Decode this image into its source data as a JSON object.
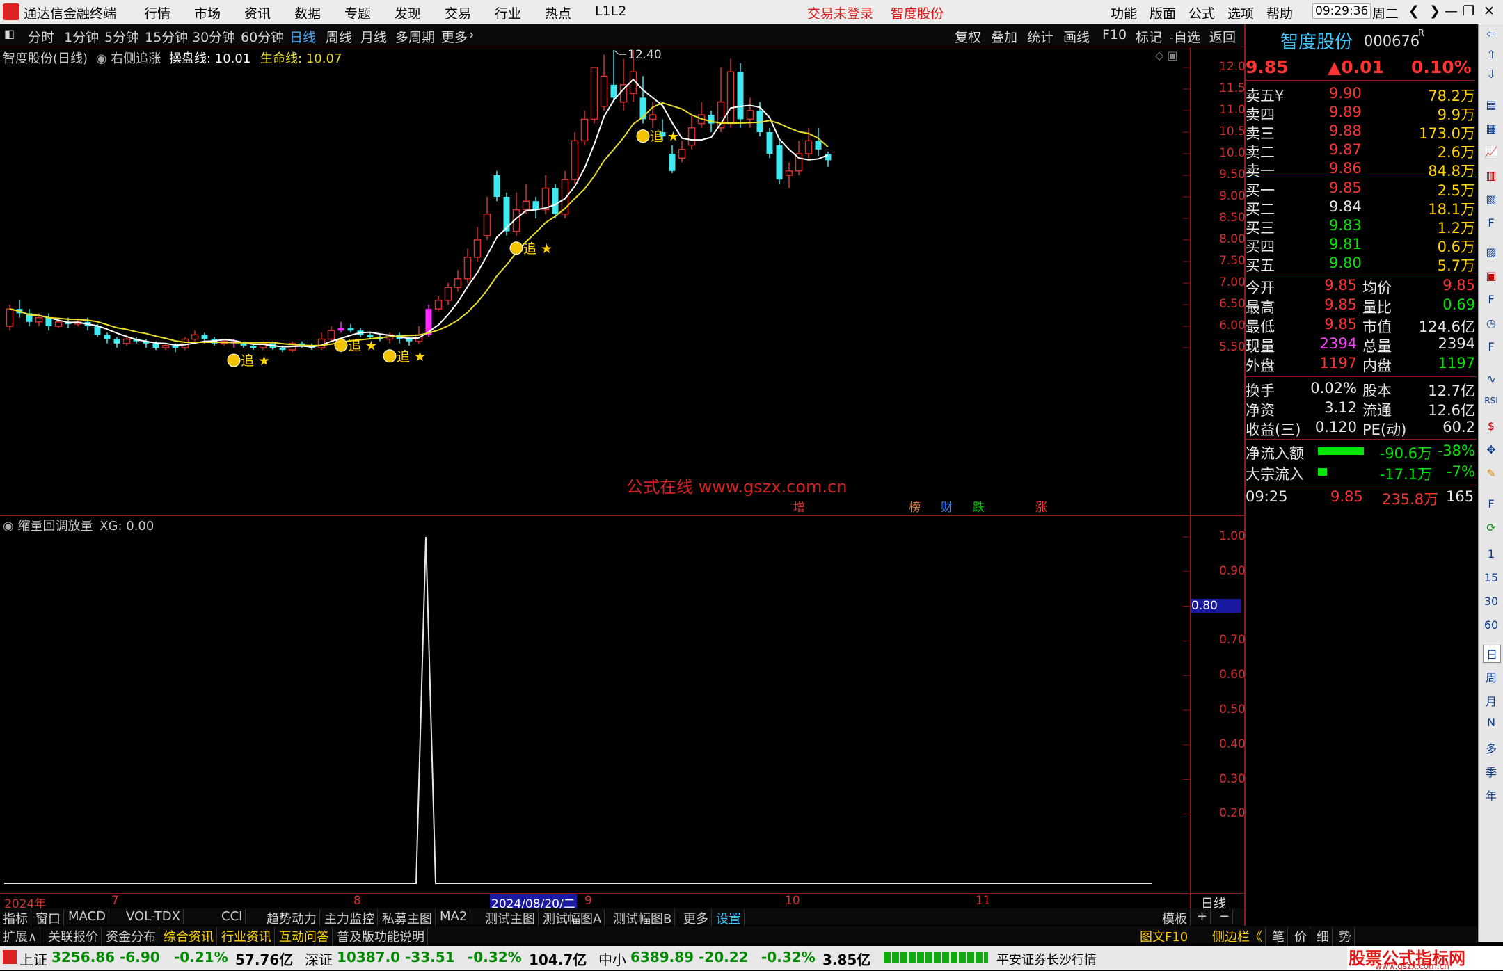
{
  "titlebar": {
    "app_name": "通达信金融终端",
    "menu": [
      "行情",
      "市场",
      "资讯",
      "数据",
      "专题",
      "发现",
      "交易",
      "行业",
      "热点",
      "L1L2"
    ],
    "login_status": "交易未登录",
    "stock_name": "智度股份",
    "right_menu": [
      "功能",
      "版面",
      "公式",
      "选项",
      "帮助"
    ],
    "time": "09:29:36",
    "weekday": "周二"
  },
  "periodbar": {
    "periods": [
      "分时",
      "1分钟",
      "5分钟",
      "15分钟",
      "30分钟",
      "60分钟",
      "日线",
      "周线",
      "月线",
      "多周期",
      "更多"
    ],
    "active_period": "日线",
    "tools": [
      "复权",
      "叠加",
      "统计",
      "画线",
      "F10",
      "标记",
      "-自选",
      "返回"
    ]
  },
  "kline": {
    "header_name": "智度股份(日线)",
    "formula": "右侧追涨",
    "line1_label": "操盘线:",
    "line1_value": "10.01",
    "line2_label": "生命线:",
    "line2_value": "10.07",
    "max_label": "12.40",
    "y_ticks": [
      "12.00",
      "11.50",
      "11.00",
      "10.50",
      "10.00",
      "9.50",
      "9.00",
      "8.50",
      "8.00",
      "7.50",
      "7.00",
      "6.50",
      "6.00",
      "5.50"
    ],
    "watermark": "公式在线  www.gszx.com.cn",
    "signal_text": "追",
    "event_markers": [
      "增",
      "榜",
      "财",
      "跌",
      "涨"
    ],
    "colors": {
      "up": "#d83030",
      "down": "#40e8f0",
      "ma_short": "#ffffff",
      "ma_long": "#e6dc28",
      "signal": "#ffd200",
      "highlight": "#ff28ff"
    }
  },
  "indicator": {
    "name": "缩量回调放量",
    "value_label": "XG: 0.00",
    "y_ticks": [
      "1.00",
      "0.90",
      "0.80",
      "0.70",
      "0.60",
      "0.50",
      "0.40",
      "0.30",
      "0.20"
    ],
    "highlight_tick": "0.80"
  },
  "xaxis": {
    "labels": [
      "2024年",
      "7",
      "8",
      "2024/08/20/二",
      "9",
      "10",
      "11"
    ],
    "period_label": "日线"
  },
  "quote": {
    "name": "智度股份",
    "code": "000676",
    "code_suffix": "R",
    "price": "9.85",
    "change": "▲0.01",
    "change_pct": "0.10%",
    "asks": [
      {
        "label": "卖五",
        "mark": "¥",
        "price": "9.90",
        "vol": "78.2万"
      },
      {
        "label": "卖四",
        "mark": "",
        "price": "9.89",
        "vol": "9.9万"
      },
      {
        "label": "卖三",
        "mark": "",
        "price": "9.88",
        "vol": "173.0万"
      },
      {
        "label": "卖二",
        "mark": "",
        "price": "9.87",
        "vol": "2.6万"
      },
      {
        "label": "卖一",
        "mark": "",
        "price": "9.86",
        "vol": "84.8万"
      }
    ],
    "bids": [
      {
        "label": "买一",
        "price": "9.85",
        "vol": "2.5万"
      },
      {
        "label": "买二",
        "price": "9.84",
        "vol": "18.1万"
      },
      {
        "label": "买三",
        "price": "9.83",
        "vol": "1.2万"
      },
      {
        "label": "买四",
        "price": "9.81",
        "vol": "0.6万"
      },
      {
        "label": "买五",
        "price": "9.80",
        "vol": "5.7万"
      }
    ],
    "stats": [
      {
        "l1": "今开",
        "v1": "9.85",
        "l2": "均价",
        "v2": "9.85"
      },
      {
        "l1": "最高",
        "v1": "9.85",
        "l2": "量比",
        "v2": "0.69"
      },
      {
        "l1": "最低",
        "v1": "9.85",
        "l2": "市值",
        "v2": "124.6亿"
      },
      {
        "l1": "现量",
        "v1": "2394",
        "l2": "总量",
        "v2": "2394"
      },
      {
        "l1": "外盘",
        "v1": "1197",
        "l2": "内盘",
        "v2": "1197"
      }
    ],
    "fundamentals": [
      {
        "l1": "换手",
        "v1": "0.02%",
        "l2": "股本",
        "v2": "12.7亿"
      },
      {
        "l1": "净资",
        "v1": "3.12",
        "l2": "流通",
        "v2": "12.6亿"
      },
      {
        "l1": "收益(三)",
        "v1": "0.120",
        "l2": "PE(动)",
        "v2": "60.2"
      }
    ],
    "flows": [
      {
        "label": "净流入额",
        "value": "-90.6万",
        "pct": "-38%",
        "bar": 0.6
      },
      {
        "label": "大宗流入",
        "value": "-17.1万",
        "pct": "-7%",
        "bar": 0.12
      }
    ],
    "tick": {
      "time": "09:25",
      "price": "9.85",
      "amount": "235.8万",
      "count": "165"
    }
  },
  "sidebar_labels": [
    "1",
    "15",
    "30",
    "60",
    "日",
    "周",
    "月",
    "N",
    "多",
    "季",
    "年"
  ],
  "tabbar1": {
    "tabs": [
      "指标",
      "窗口",
      "MACD",
      "VOL-TDX",
      "CCI",
      "趋势动力",
      "主力监控",
      "私募主图",
      "MA2",
      "测试主图",
      "测试幅图A",
      "测试幅图B",
      "更多",
      "设置"
    ],
    "right": [
      "模板",
      "+",
      "−"
    ]
  },
  "tabbar2": {
    "tabs": [
      "扩展∧",
      "关联报价",
      "资金分布",
      "综合资讯",
      "行业资讯",
      "互动问答",
      "普及版功能说明"
    ],
    "right": [
      "图文F10",
      "侧边栏《",
      "笔",
      "价",
      "细",
      "势"
    ]
  },
  "statusbar": {
    "indices": [
      {
        "name": "上证",
        "value": "3256.86",
        "chg": "-6.90",
        "pct": "-0.21%",
        "amount": "57.76亿"
      },
      {
        "name": "深证",
        "value": "10387.0",
        "chg": "-33.51",
        "pct": "-0.32%",
        "amount": "104.7亿"
      },
      {
        "name": "中小",
        "value": "6389.89",
        "chg": "-20.22",
        "pct": "-0.32%",
        "amount": "3.85亿"
      }
    ],
    "broker": "平安证券长沙行情",
    "brand": "股票公式指标网",
    "brand_url": "www.gszx.com.cn"
  }
}
